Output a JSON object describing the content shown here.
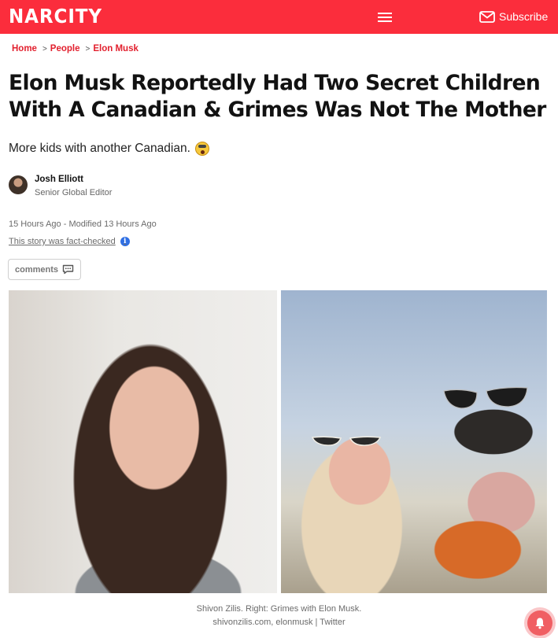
{
  "header": {
    "logo": "NARCITY",
    "subscribe_label": "Subscribe",
    "brand_color": "#fb2d3c",
    "menu_icon": "hamburger-icon",
    "mail_icon": "mail-icon"
  },
  "breadcrumb": [
    "Home",
    "People",
    "Elon Musk"
  ],
  "article": {
    "title": "Elon Musk Reportedly Had Two Secret Children With A Canadian & Grimes Was Not The Mother",
    "dek": "More kids with another Canadian.",
    "dek_emoji": "shocked-face-emoji",
    "author": {
      "name": "Josh Elliott",
      "role": "Senior Global Editor"
    },
    "published": "15 Hours Ago",
    "modified": "- Modified 13 Hours Ago",
    "fact_check": "This story was fact-checked",
    "comments_label": "comments"
  },
  "images": {
    "caption_line1": "Shivon Zilis. Right: Grimes with Elon Musk.",
    "caption_line2": "shivonzilis.com, elonmusk | Twitter"
  }
}
